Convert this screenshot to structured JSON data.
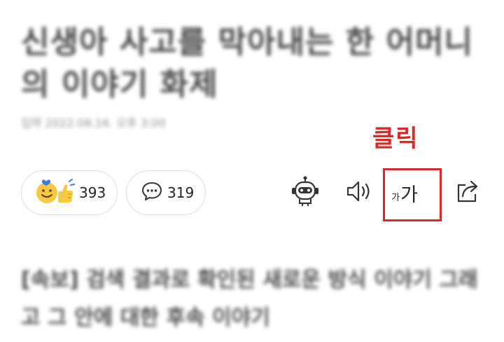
{
  "article": {
    "headline_line1": "신생아 사고를 막아내는 한 어머니",
    "headline_line2": "의 이야기 화제",
    "date": "입력 2022.08.16. 오후 3:00"
  },
  "annotation": {
    "label": "클릭",
    "color": "#d52b2b"
  },
  "reactions": {
    "like_count": "393",
    "comment_count": "319",
    "like_icon": "smiley-thumbs-up-icon",
    "comment_icon": "speech-bubble-icon"
  },
  "toolbar": {
    "robot_icon": "summary-bot-icon",
    "speaker_icon": "speaker-icon",
    "font_small": "가",
    "font_large": "가",
    "share_icon": "share-icon"
  },
  "related": {
    "line1": "[속보] 검색 결과로 확인된 새로운 방식 이야기 그래",
    "line2": "고 그 안에 대한 후속 이야기"
  },
  "colors": {
    "accent_red": "#d52b2b",
    "border_gray": "#dedede",
    "emoji_yellow": "#f7c842",
    "heart_blue": "#3c7be0"
  }
}
